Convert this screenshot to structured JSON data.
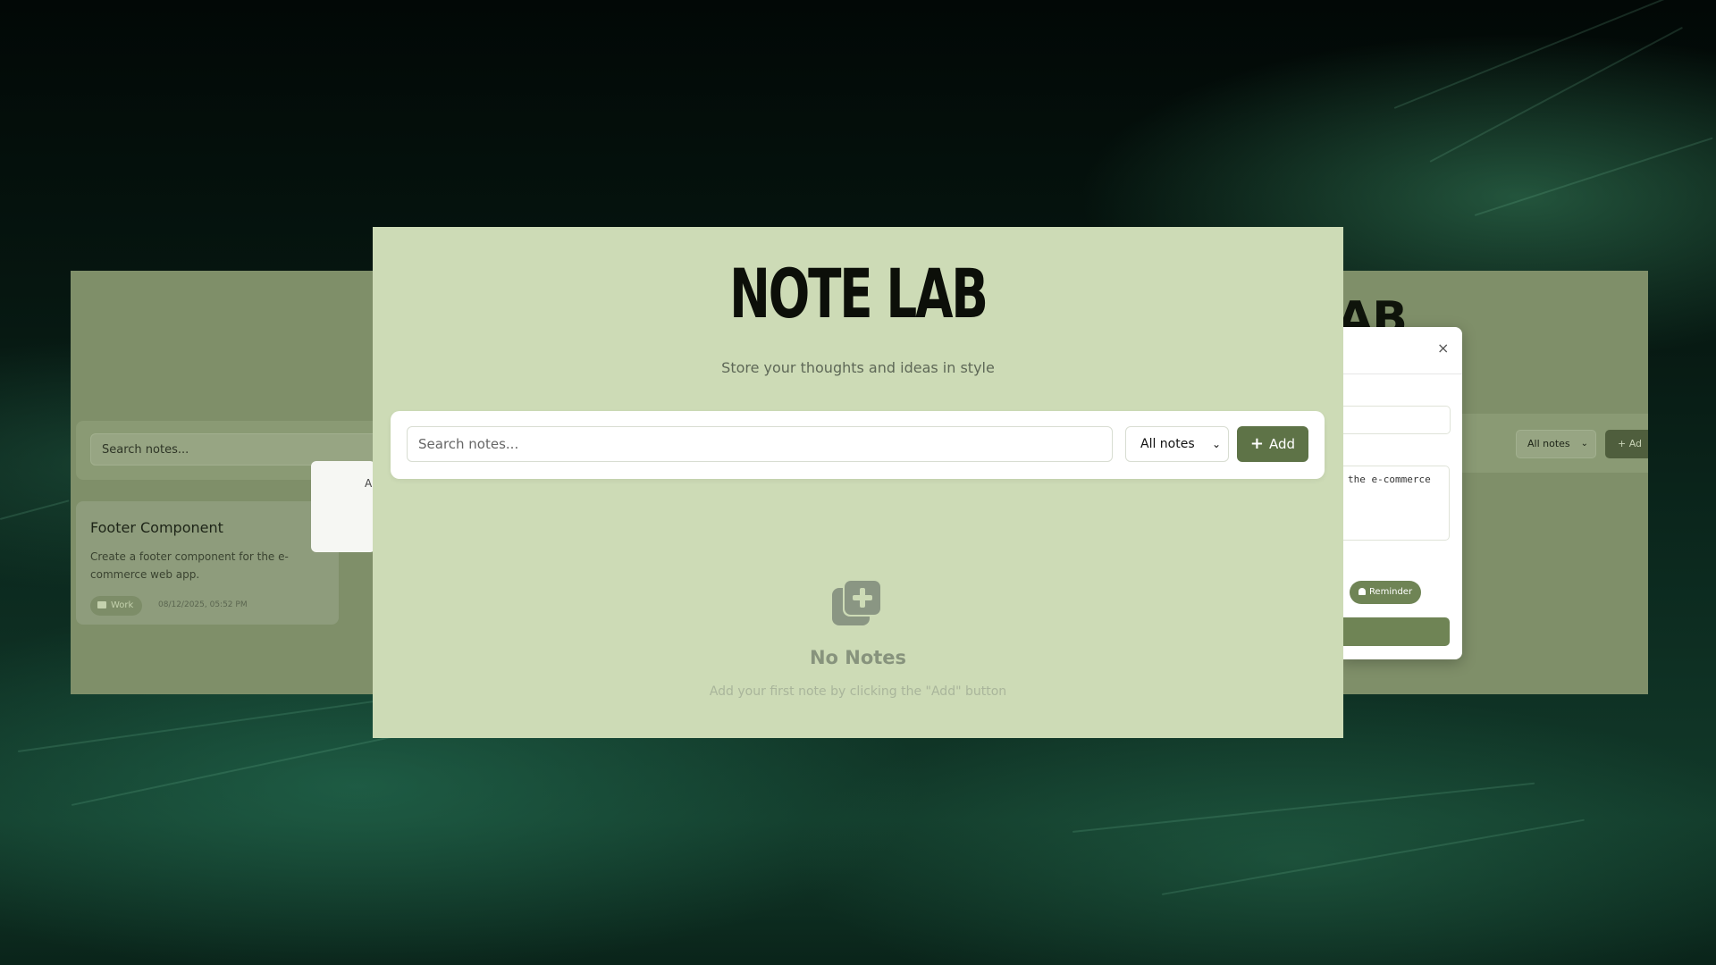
{
  "background": {
    "accent": "#0c2a1f"
  },
  "left_window": {
    "search_placeholder": "Search notes...",
    "note": {
      "title": "Footer Component",
      "description": "Create a footer component for the e-commerce web app.",
      "tag": "Work",
      "date": "08/12/2025, 05:52 PM"
    },
    "popup_text": "A"
  },
  "right_window": {
    "title_fragment": "AB",
    "filter": "All notes",
    "add_label": "Ad",
    "modal": {
      "close_symbol": "×",
      "textarea_fragment": "the e-commerce",
      "reminder_label": "Reminder"
    }
  },
  "main": {
    "title": "NOTE LAB",
    "subtitle": "Store your thoughts and ideas in style",
    "search_placeholder": "Search notes...",
    "filter": "All notes",
    "add_label": "Add",
    "empty_title": "No Notes",
    "empty_hint": "Add your first note by clicking the \"Add\" button",
    "accent": "#5e7347"
  }
}
